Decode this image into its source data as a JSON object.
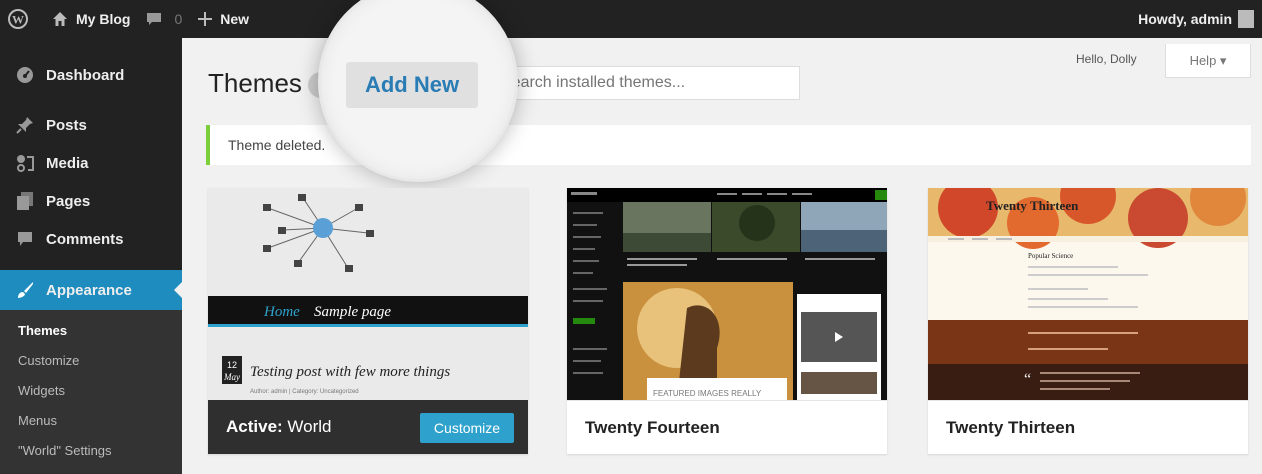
{
  "adminbar": {
    "site_name": "My Blog",
    "comments_count": "0",
    "new_label": "New",
    "greeting": "Howdy, admin"
  },
  "sidebar": {
    "items": [
      {
        "label": "Dashboard",
        "icon": "dashboard-icon"
      },
      {
        "label": "Posts",
        "icon": "pin-icon"
      },
      {
        "label": "Media",
        "icon": "media-icon"
      },
      {
        "label": "Pages",
        "icon": "pages-icon"
      },
      {
        "label": "Comments",
        "icon": "comments-icon"
      },
      {
        "label": "Appearance",
        "icon": "appearance-icon"
      }
    ],
    "submenu": [
      "Themes",
      "Customize",
      "Widgets",
      "Menus",
      "\"World\" Settings"
    ]
  },
  "main": {
    "title": "Themes",
    "add_new_label": "Add New",
    "search_placeholder": "Search installed themes...",
    "hello": "Hello, Dolly",
    "help_label": "Help ▾",
    "notice": "Theme deleted."
  },
  "themes": [
    {
      "name": "World",
      "active_prefix": "Active:",
      "customize_label": "Customize",
      "nav": [
        "Home",
        "Sample page"
      ],
      "post_title": "Testing post with few more things",
      "date_day": "12",
      "date_month": "May",
      "author_line": "Author: admin | Category: Uncategorized"
    },
    {
      "name": "Twenty Fourteen",
      "featured_label": "FEATURED IMAGES REALLY"
    },
    {
      "name": "Twenty Thirteen",
      "header_title": "Twenty Thirteen",
      "post_title": "Popular Science"
    }
  ],
  "colors": {
    "accent": "#1e8cbe",
    "notice_border": "#7ad03a",
    "customize_button": "#2ea2cc"
  }
}
